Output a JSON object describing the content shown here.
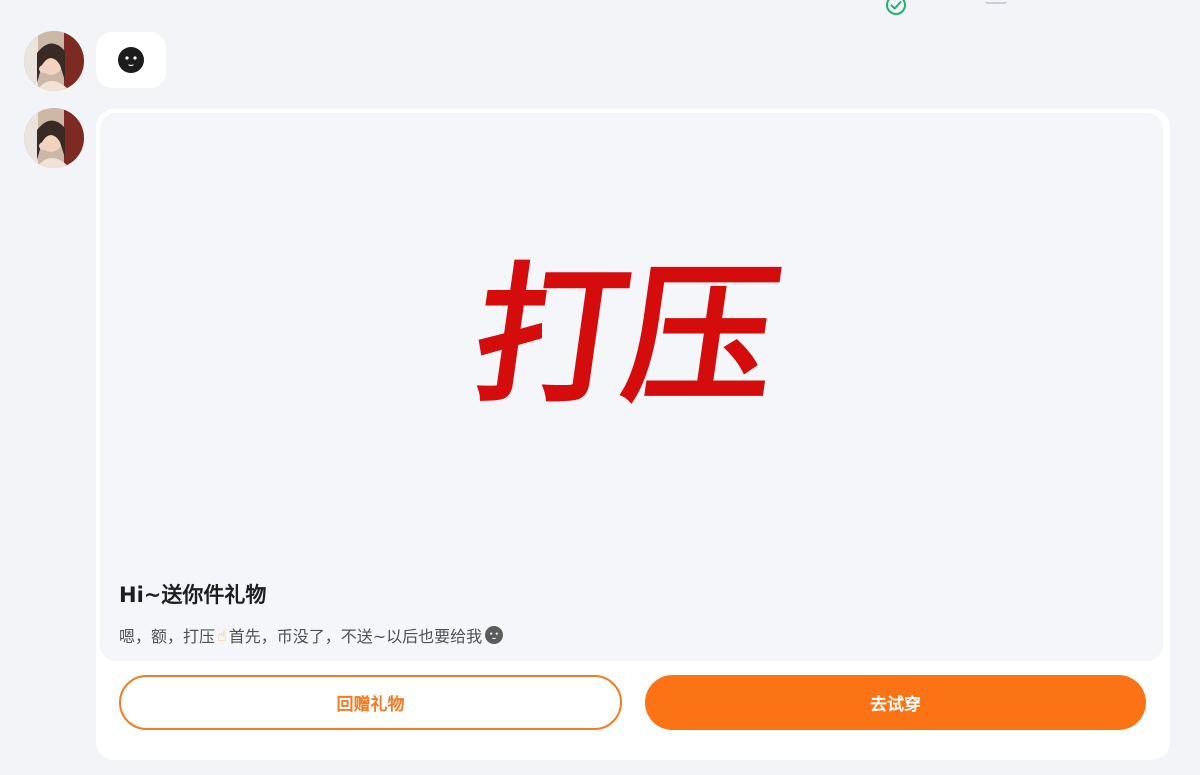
{
  "messages": [
    {
      "type": "emoji",
      "emoji_icon": "dark-face-emoji-icon"
    },
    {
      "type": "gift-card",
      "image_text": "打压",
      "title": "Hi~送你件礼物",
      "message_part1": "嗯，额，打压",
      "pointing_emoji": "☝",
      "message_part2": "首先，币没了，不送~以后也要给我",
      "message_emoji_icon": "dark-face-emoji-icon",
      "return_gift_label": "回赠礼物",
      "try_on_label": "去试穿"
    }
  ],
  "colors": {
    "accent": "#fb7314",
    "outline_accent": "#f27b23",
    "calligraphy_red": "#d40c0c",
    "check_green": "#1fb36a",
    "background": "#f3f4f8"
  }
}
